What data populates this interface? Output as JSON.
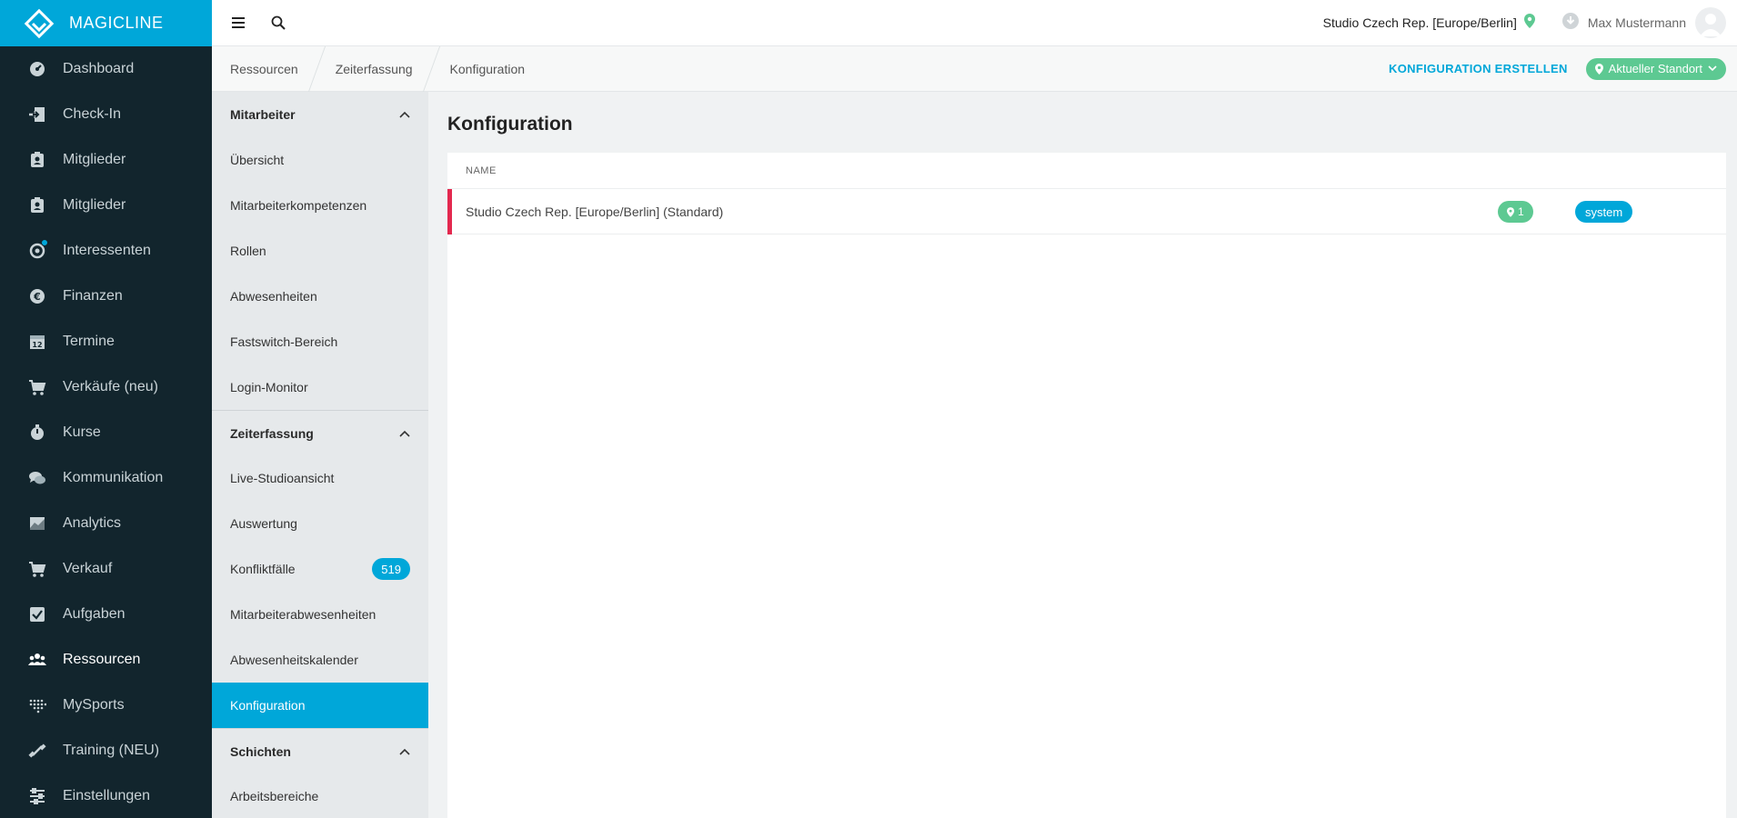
{
  "brand": {
    "name": "MAGICLINE"
  },
  "leftnav": {
    "items": [
      {
        "label": "Dashboard",
        "icon": "dashboard-icon"
      },
      {
        "label": "Check-In",
        "icon": "check-in-icon"
      },
      {
        "label": "Mitglieder",
        "icon": "members-icon"
      },
      {
        "label": "Mitglieder",
        "icon": "members-icon"
      },
      {
        "label": "Interessenten",
        "icon": "prospects-icon"
      },
      {
        "label": "Finanzen",
        "icon": "euro-icon"
      },
      {
        "label": "Termine",
        "icon": "calendar-icon"
      },
      {
        "label": "Verkäufe (neu)",
        "icon": "cart-icon"
      },
      {
        "label": "Kurse",
        "icon": "stopwatch-icon"
      },
      {
        "label": "Kommunikation",
        "icon": "chat-icon"
      },
      {
        "label": "Analytics",
        "icon": "chart-icon"
      },
      {
        "label": "Verkauf",
        "icon": "cart-icon"
      },
      {
        "label": "Aufgaben",
        "icon": "checkbox-icon"
      },
      {
        "label": "Ressourcen",
        "icon": "people-icon",
        "active": true
      },
      {
        "label": "MySports",
        "icon": "dots-grid-icon"
      },
      {
        "label": "Training (NEU)",
        "icon": "dumbbell-icon"
      },
      {
        "label": "Einstellungen",
        "icon": "sliders-icon"
      }
    ]
  },
  "topbar": {
    "studio": "Studio Czech Rep. [Europe/Berlin]",
    "user": "Max Mustermann"
  },
  "breadcrumb": [
    "Ressourcen",
    "Zeiterfassung",
    "Konfiguration"
  ],
  "actions": {
    "create": "KONFIGURATION ERSTELLEN",
    "location": "Aktueller Standort"
  },
  "subnav": {
    "groups": [
      {
        "title": "Mitarbeiter",
        "items": [
          {
            "label": "Übersicht"
          },
          {
            "label": "Mitarbeiterkompetenzen"
          },
          {
            "label": "Rollen"
          },
          {
            "label": "Abwesenheiten"
          },
          {
            "label": "Fastswitch-Bereich"
          },
          {
            "label": "Login-Monitor"
          }
        ]
      },
      {
        "title": "Zeiterfassung",
        "items": [
          {
            "label": "Live-Studioansicht"
          },
          {
            "label": "Auswertung"
          },
          {
            "label": "Konfliktfälle",
            "badge": "519"
          },
          {
            "label": "Mitarbeiterabwesenheiten"
          },
          {
            "label": "Abwesenheitskalender"
          },
          {
            "label": "Konfiguration",
            "active": true
          }
        ]
      },
      {
        "title": "Schichten",
        "items": [
          {
            "label": "Arbeitsbereiche"
          }
        ]
      }
    ]
  },
  "main": {
    "title": "Konfiguration",
    "column_name": "NAME",
    "rows": [
      {
        "name": "Studio Czech Rep. [Europe/Berlin] (Standard)",
        "location_count": "1",
        "tag": "system"
      }
    ]
  },
  "colors": {
    "accent": "#00a7d9",
    "nav_bg": "#12252d",
    "success": "#5dc992",
    "row_marker": "#e3294f"
  }
}
